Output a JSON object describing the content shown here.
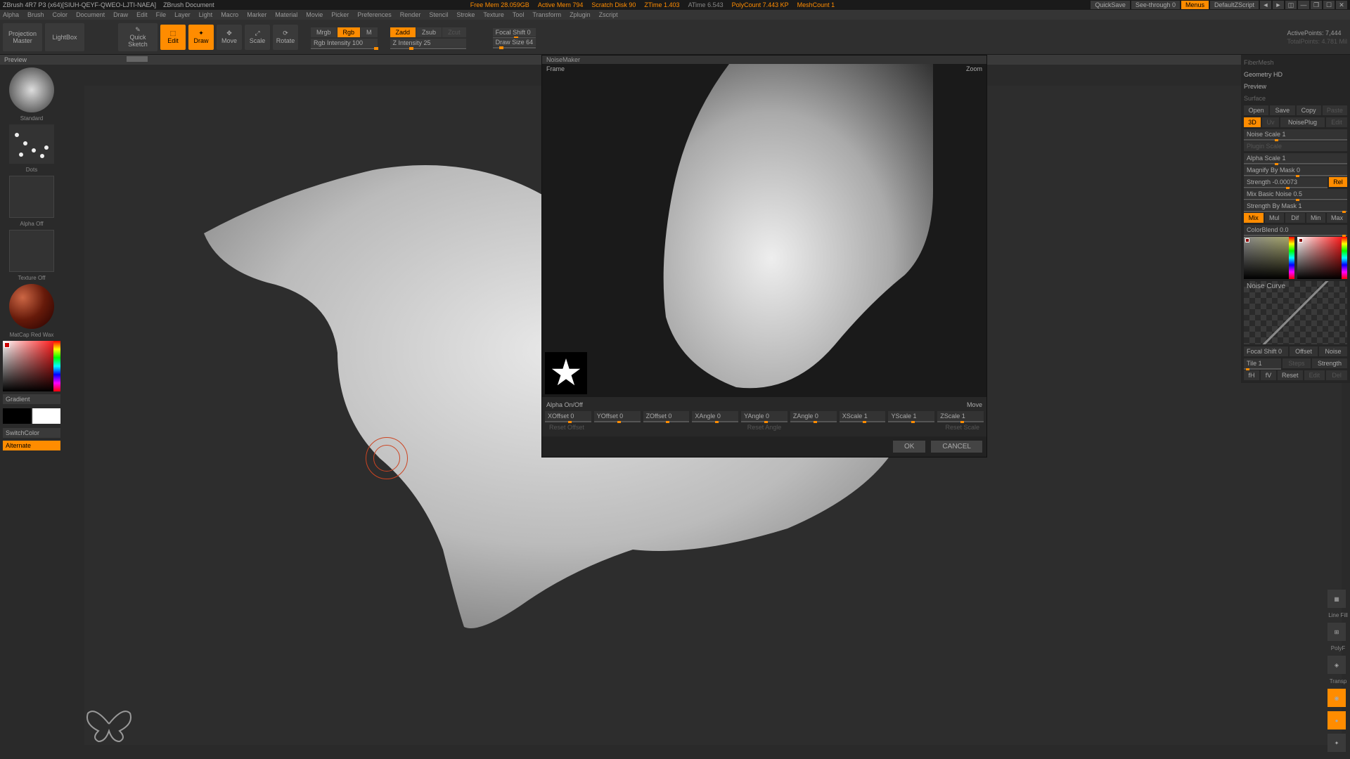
{
  "titlebar": {
    "app": "ZBrush 4R7 P3 (x64)[SIUH-QEYF-QWEO-LJTI-NAEA]",
    "doc": "ZBrush Document",
    "stats": {
      "freemem": "Free Mem 28.059GB",
      "activemem": "Active Mem 794",
      "scratch": "Scratch Disk 90",
      "ztime": "ZTime 1.403",
      "atime": "ATime 6.543",
      "polycount": "PolyCount 7.443 KP",
      "meshcount": "MeshCount 1"
    },
    "quicksave": "QuickSave",
    "seethrough": "See-through   0",
    "menus": "Menus",
    "script": "DefaultZScript"
  },
  "menubar": [
    "Alpha",
    "Brush",
    "Color",
    "Document",
    "Draw",
    "Edit",
    "File",
    "Layer",
    "Light",
    "Macro",
    "Marker",
    "Material",
    "Movie",
    "Picker",
    "Preferences",
    "Render",
    "Stencil",
    "Stroke",
    "Texture",
    "Tool",
    "Transform",
    "Zplugin",
    "Zscript"
  ],
  "toolbar": {
    "projection": "Projection\nMaster",
    "lightbox": "LightBox",
    "quicksketch": "Quick\nSketch",
    "edit": "Edit",
    "draw": "Draw",
    "move": "Move",
    "scale": "Scale",
    "rotate": "Rotate",
    "mrgb": "Mrgb",
    "rgb": "Rgb",
    "m": "M",
    "rgbIntensity": "Rgb Intensity 100",
    "zadd": "Zadd",
    "zsub": "Zsub",
    "zcut": "Zcut",
    "zIntensity": "Z Intensity 25",
    "focalShift": "Focal Shift 0",
    "drawSize": "Draw Size 64",
    "activePoints": "ActivePoints: 7,444",
    "totalPoints": "TotalPoints: 4.781 Mil"
  },
  "preview": "Preview",
  "sidebar": {
    "brush": "Standard",
    "stroke": "Dots",
    "alpha": "Alpha Off",
    "texture": "Texture Off",
    "material": "MatCap Red Wax",
    "gradient": "Gradient",
    "switchcolor": "SwitchColor",
    "alternate": "Alternate"
  },
  "dialog": {
    "title": "NoiseMaker",
    "frame": "Frame",
    "zoom": "Zoom",
    "alphaToggle": "Alpha On/Off",
    "open": "Open",
    "save": "Save",
    "copy": "Copy",
    "paste": "Paste",
    "mode3d": "3D",
    "uv": "Uv",
    "noiseplug": "NoisePlug",
    "edit": "Edit",
    "noiseScale": "Noise Scale   1",
    "pluginScale": "Plugin  Scale",
    "alphaScale": "Alpha Scale   1",
    "magnify": "Magnify By Mask 0",
    "strength": "Strength -0.00073",
    "rel": "Rel",
    "mixBasic": "Mix Basic Noise 0.5",
    "strengthMask": "Strength By Mask 1",
    "mix": "Mix",
    "mul": "Mul",
    "dif": "Dif",
    "min": "Min",
    "max": "Max",
    "colorblend": "ColorBlend 0.0",
    "noiseCurve": "Noise Curve",
    "focalShift2": "Focal Shift 0",
    "offset": "Offset",
    "noise": "Noise",
    "tile": "Tile 1",
    "steps": "Steps",
    "strength2": "Strength",
    "fh": "fH",
    "fv": "fV",
    "reset": "Reset",
    "edit2": "Edit",
    "del": "Del",
    "move": "Move",
    "xoffset": "XOffset 0",
    "yoffset": "YOffset 0",
    "zoffset": "ZOffset 0",
    "xangle": "XAngle 0",
    "yangle": "YAngle 0",
    "zangle": "ZAngle 0",
    "xscale": "XScale 1",
    "yscale": "YScale 1",
    "zscale": "ZScale 1",
    "resetOffset": "Reset Offset",
    "resetAngle": "Reset Angle",
    "resetScale": "Reset Scale",
    "ok": "OK",
    "cancel": "CANCEL"
  },
  "rightPanel": {
    "fibermesh": "FiberMesh",
    "geomhd": "Geometry HD",
    "preview": "Preview",
    "surface": "Surface"
  },
  "rightToolbar": {
    "linefill": "Line Fill",
    "polyf": "PolyF",
    "transp": "Transp"
  }
}
